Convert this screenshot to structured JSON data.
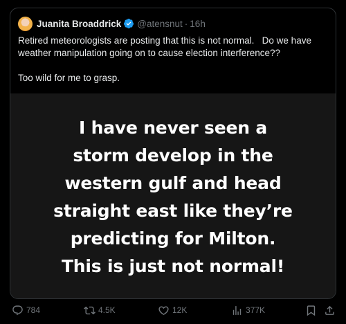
{
  "tweet": {
    "author_name": "Juanita Broaddrick",
    "handle": "@atensnut",
    "separator": "·",
    "time": "16h",
    "text": "Retired meteorologists are posting that this is not normal.   Do we have weather manipulation going on to cause election interference??\n\nToo wild for me to grasp.",
    "media_text": "I have never seen a\nstorm develop in the\nwestern gulf and head\nstraight east like they’re\npredicting for Milton.\nThis is just not normal!"
  },
  "actions": {
    "replies": "784",
    "reposts": "4.5K",
    "likes": "12K",
    "views": "377K"
  },
  "colors": {
    "background": "#000000",
    "text": "#e7e9ea",
    "muted": "#71767b",
    "verified": "#1d9bf0",
    "media_bg": "#161616"
  }
}
